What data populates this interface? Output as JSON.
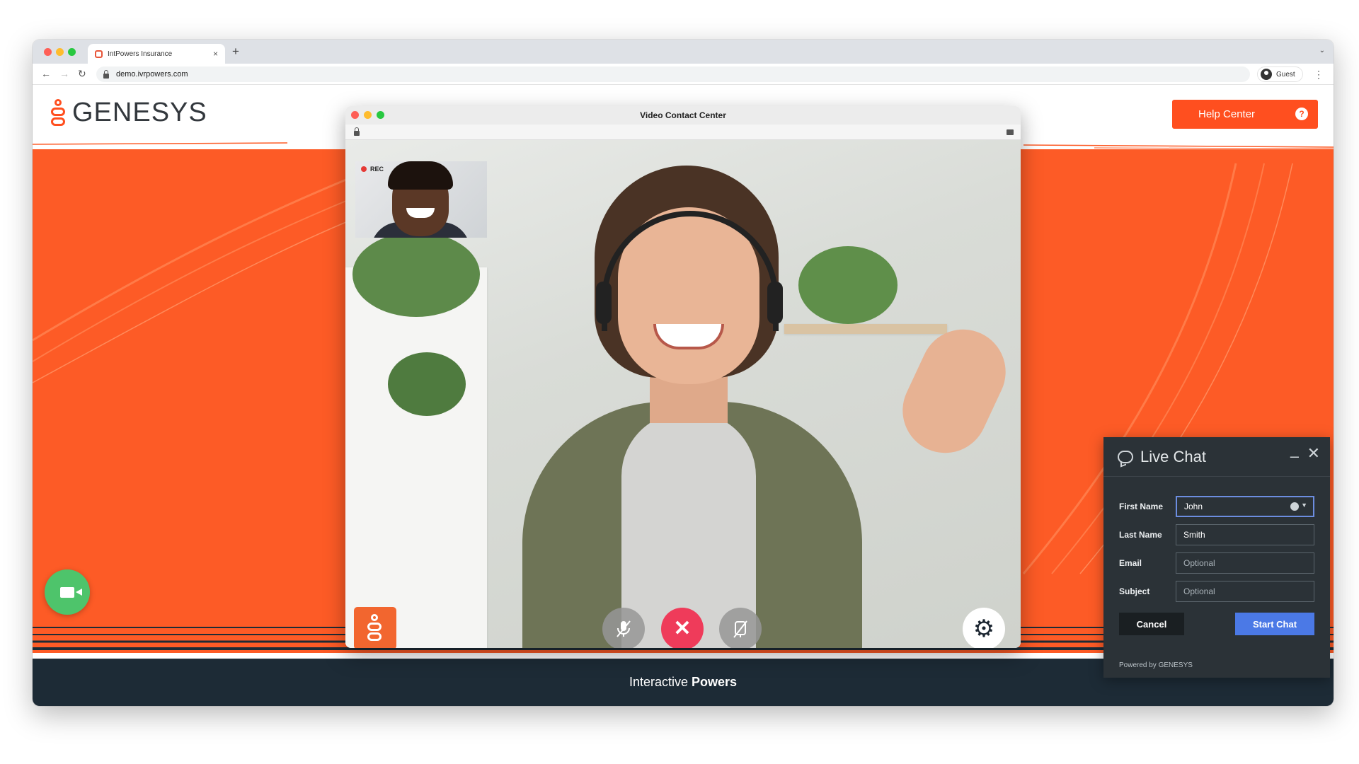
{
  "browser": {
    "tab_title": "IntPowers Insurance",
    "tab_close": "×",
    "new_tab": "+",
    "url": "demo.ivrpowers.com",
    "profile_label": "Guest",
    "nav_back": "←",
    "nav_forward": "→",
    "nav_reload": "↻",
    "menu": "⋮",
    "tabs_caret": "⌄"
  },
  "header": {
    "logo_text": "GENESYS",
    "help_label": "Help Center",
    "help_icon": "?"
  },
  "footer": {
    "text_regular": "Interactive",
    "text_bold": "Powers"
  },
  "video_window": {
    "title": "Video Contact Center",
    "rec_label": "REC",
    "icons": [
      "lock-icon",
      "camera-icon",
      "mic-off-icon",
      "end-call-icon",
      "video-off-icon",
      "gear-icon",
      "genesys-logo-icon"
    ],
    "end_glyph": "✕",
    "gear_glyph": "⚙",
    "mic_glyph": "🎙",
    "cam_glyph": "📷"
  },
  "live_chat": {
    "title": "Live Chat",
    "minimize": "–",
    "close": "✕",
    "fields": [
      {
        "label": "First Name",
        "value": "John",
        "placeholder": ""
      },
      {
        "label": "Last Name",
        "value": "Smith",
        "placeholder": ""
      },
      {
        "label": "Email",
        "value": "",
        "placeholder": "Optional"
      },
      {
        "label": "Subject",
        "value": "",
        "placeholder": "Optional"
      }
    ],
    "cancel_label": "Cancel",
    "start_label": "Start Chat",
    "powered_by": "Powered by",
    "powered_brand": "GENESYS"
  },
  "colors": {
    "brand_orange": "#fd5b26",
    "footer_navy": "#1d2b36",
    "fab_green": "#4ec46b",
    "end_call_red": "#ef3b5a",
    "start_chat_blue": "#4b79e6"
  }
}
